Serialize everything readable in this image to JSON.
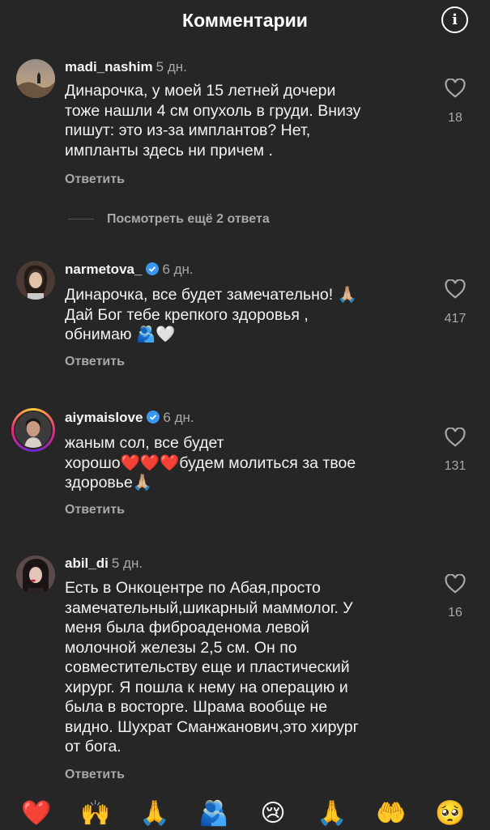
{
  "header": {
    "title": "Комментарии",
    "info_icon": "info-icon"
  },
  "reply_label": "Ответить",
  "view_more": "Посмотреть ещё 2 ответа",
  "comments": [
    {
      "username": "madi_nashim",
      "time": "5 дн.",
      "verified": false,
      "text": "Динарочка, у моей 15 летней дочери\nтоже нашли 4 см опухоль в груди. Внизу\nпишут: это из-за имплантов? Нет,\nимпланты здесь ни причем .",
      "likes": "18"
    },
    {
      "username": "narmetova_",
      "time": "6 дн.",
      "verified": true,
      "text": "Динарочка, все будет замечательно! 🙏🏼\nДай Бог тебе крепкого здоровья ,\nобнимаю 🫂🤍",
      "likes": "417"
    },
    {
      "username": "aiymaislove",
      "time": "6 дн.",
      "verified": true,
      "text": "жаным сол, все будет\nхорошо❤️❤️❤️будем молиться за твое\nздоровье🙏🏼",
      "likes": "131"
    },
    {
      "username": "abil_di",
      "time": "5 дн.",
      "verified": false,
      "text": "Есть в Онкоцентре по Абая,просто\nзамечательный,шикарный маммолог. У\nменя была фиброаденома левой\nмолочной железы 2,5 см. Он по\nсовместительству еще и пластический\nхирург. Я пошла к нему на операцию и\nбыла в восторге. Шрама вообще не\nвидно. Шухрат Сманжанович,это хирург\nот бога.",
      "likes": "16"
    }
  ],
  "quick_reactions": [
    "❤️",
    "🙌",
    "🙏",
    "🫂",
    "😢",
    "🙏",
    "🤲",
    "🥺"
  ],
  "colors": {
    "background": "#262626",
    "muted": "#a8a8a8",
    "verified": "#3897f0"
  }
}
